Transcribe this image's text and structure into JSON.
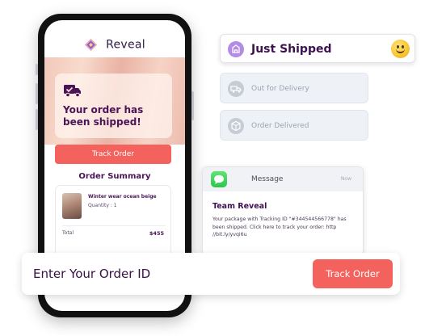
{
  "brand": {
    "name": "Reveal"
  },
  "hero": {
    "title": "Your order has been shipped!",
    "icon": "truck-check-icon"
  },
  "phone_track_button": "Track Order",
  "summary": {
    "title": "Order Summary",
    "product_name": "Winter wear ocean beige",
    "quantity": "Quantity : 1",
    "total_label": "Total",
    "total_value": "$455"
  },
  "statuses": [
    {
      "label": "Just Shipped",
      "icon": "package-icon",
      "active": true,
      "emoji": "smiling-emoji"
    },
    {
      "label": "Out for Delivery",
      "icon": "delivery-truck-icon",
      "active": false
    },
    {
      "label": "Order Delivered",
      "icon": "box-check-icon",
      "active": false
    }
  ],
  "message": {
    "app": "Message",
    "time": "Now",
    "sender": "Team Reveal",
    "body": "Your package with Tracking ID \"#344544566778\" has been shipped. Click here to track your order: http //bit.ly/yvqi6u"
  },
  "order_bar": {
    "placeholder": "Enter Your Order ID",
    "button": "Track Order"
  },
  "colors": {
    "accent": "#f4625e",
    "brand_purple": "#4a1457",
    "active_icon": "#b48ce6"
  }
}
